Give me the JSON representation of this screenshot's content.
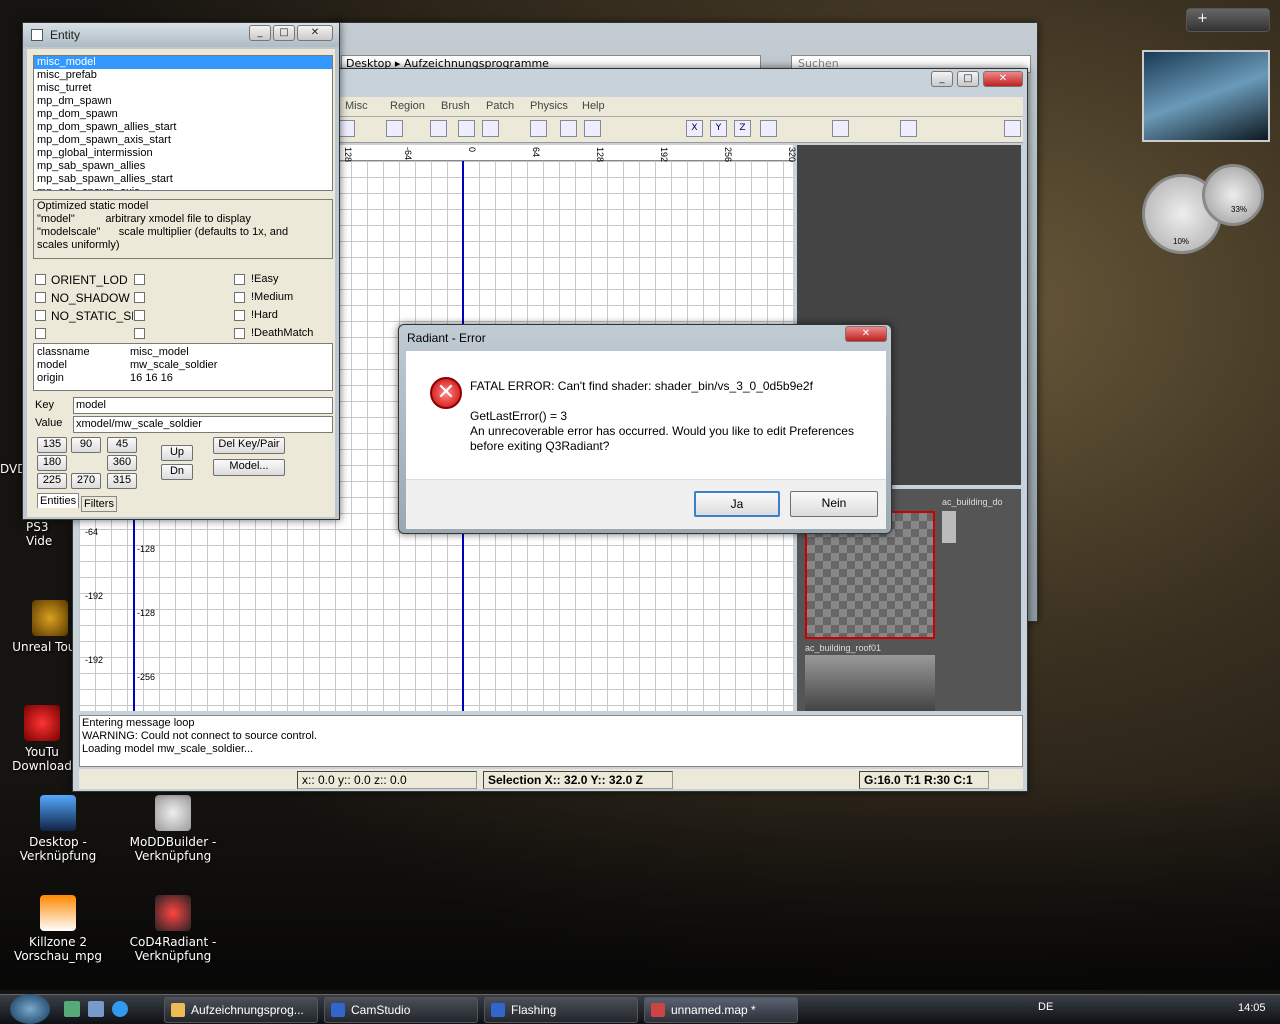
{
  "desktop_icons": [
    {
      "label": "Unreal Tourn",
      "icon": "unreal-icon"
    },
    {
      "label": "YouTu\nDownload",
      "icon": "youtube-icon"
    },
    {
      "label": "Desktop -\nVerknüpfung",
      "icon": "desktop-icon"
    },
    {
      "label": "MoDDBuilder -\nVerknüpfung",
      "icon": "gear-icon"
    },
    {
      "label": "Killzone 2\nVorschau_mpg",
      "icon": "vlc-icon"
    },
    {
      "label": "CoD4Radiant -\nVerknüpfung",
      "icon": "atom-icon"
    },
    {
      "label": "PS3 Vide",
      "icon": "ps3-icon"
    },
    {
      "label": "DVD",
      "icon": "dvd-icon"
    }
  ],
  "explorer": {
    "breadcrumb": "Desktop ▸ Aufzeichnungsprogramme",
    "search_placeholder": "Suchen"
  },
  "radiant": {
    "menu": [
      "Misc",
      "Region",
      "Brush",
      "Patch",
      "Physics",
      "Help"
    ],
    "top_ruler": [
      "128",
      "-64",
      "0",
      "64",
      "128",
      "192",
      "256",
      "320"
    ],
    "left_ruler": [
      "-64",
      "-128",
      "-192",
      "-128",
      "-192",
      "-256"
    ],
    "console": [
      "Entering message loop",
      "WARNING: Could not connect to source control.",
      "Loading model mw_scale_soldier..."
    ],
    "status": {
      "coords": "x:: 0.0  y:: 0.0  z:: 0.0",
      "selection": "Selection X:: 32.0  Y:: 32.0  Z",
      "grid": "G:16.0 T:1 R:30 C:1"
    },
    "textures": [
      "ac_building_do",
      "ac_building_roof01"
    ]
  },
  "entity": {
    "title": "Entity",
    "classes": [
      "misc_model",
      "misc_prefab",
      "misc_turret",
      "mp_dm_spawn",
      "mp_dom_spawn",
      "mp_dom_spawn_allies_start",
      "mp_dom_spawn_axis_start",
      "mp_global_intermission",
      "mp_sab_spawn_allies",
      "mp_sab_spawn_allies_start",
      "mp_sab_spawn_axis"
    ],
    "description": [
      "Optimized static model",
      "\"model\"          arbitrary xmodel file to display",
      "\"modelscale\"      scale multiplier (defaults to 1x, and",
      "scales uniformly)"
    ],
    "flags_left": [
      "ORIENT_LOD",
      "NO_SHADOW",
      "NO_STATIC_SH..."
    ],
    "flags_right": [
      "!Easy",
      "!Medium",
      "!Hard",
      "!DeathMatch"
    ],
    "props": [
      [
        "classname",
        "misc_model"
      ],
      [
        "model",
        "mw_scale_soldier"
      ],
      [
        "origin",
        "16 16 16"
      ]
    ],
    "key_label": "Key",
    "key_value": "model",
    "value_label": "Value",
    "value_value": "xmodel/mw_scale_soldier",
    "angles": [
      "135",
      "90",
      "45",
      "180",
      "",
      "360",
      "225",
      "270",
      "315"
    ],
    "up": "Up",
    "dn": "Dn",
    "del": "Del Key/Pair",
    "model_btn": "Model...",
    "tabs": [
      "Entities",
      "Filters"
    ]
  },
  "dialog": {
    "title": "Radiant - Error",
    "line1": "FATAL ERROR: Can't find shader: shader_bin/vs_3_0_0d5b9e2f",
    "line2": "GetLastError() = 3",
    "line3": "An unrecoverable error has occurred. Would you like to edit Preferences",
    "line4": "before exiting Q3Radiant?",
    "yes": "Ja",
    "no": "Nein"
  },
  "gadget": {
    "cpu": "10%",
    "ram": "33%"
  },
  "taskbar": {
    "items": [
      "Aufzeichnungsprog...",
      "CamStudio",
      "Flashing",
      "unnamed.map *"
    ],
    "lang": "DE",
    "time": "14:05"
  }
}
